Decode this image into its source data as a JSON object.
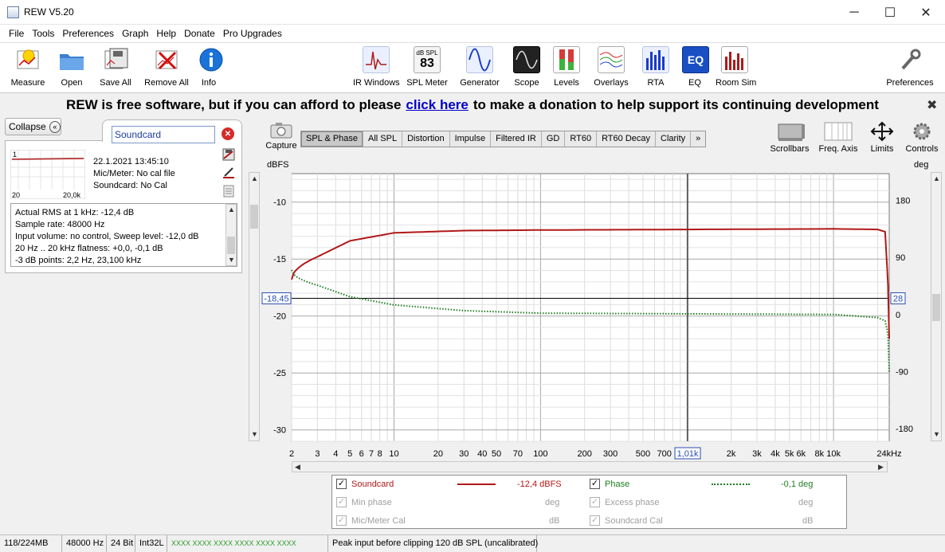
{
  "window": {
    "title": "REW V5.20",
    "minimize": "─",
    "maximize": "☐",
    "close": "✕"
  },
  "menu": [
    "File",
    "Tools",
    "Preferences",
    "Graph",
    "Help",
    "Donate",
    "Pro Upgrades"
  ],
  "toolbar": {
    "left": [
      {
        "label": "Measure",
        "icon": "microphone-icon"
      },
      {
        "label": "Open",
        "icon": "folder-icon"
      },
      {
        "label": "Save All",
        "icon": "save-all-icon"
      },
      {
        "label": "Remove All",
        "icon": "remove-all-icon"
      },
      {
        "label": "Info",
        "icon": "info-icon"
      }
    ],
    "center": [
      {
        "label": "IR Windows",
        "icon": "ir-windows-icon"
      },
      {
        "label": "SPL Meter",
        "icon": "spl-meter-icon",
        "badge_top": "dB SPL",
        "badge_value": "83"
      },
      {
        "label": "Generator",
        "icon": "generator-icon"
      },
      {
        "label": "Scope",
        "icon": "scope-icon"
      },
      {
        "label": "Levels",
        "icon": "levels-icon"
      },
      {
        "label": "Overlays",
        "icon": "overlays-icon"
      },
      {
        "label": "RTA",
        "icon": "rta-icon"
      },
      {
        "label": "EQ",
        "icon": "eq-icon"
      },
      {
        "label": "Room Sim",
        "icon": "room-sim-icon"
      }
    ],
    "right": {
      "label": "Preferences",
      "icon": "wrench-icon"
    }
  },
  "banner": {
    "before": "REW is free software, but if you can afford to please",
    "link": "click here",
    "after": "to make a donation to help support its continuing development",
    "close": "✖"
  },
  "left_panel": {
    "collapse": "Collapse",
    "measurement_name": "Soundcard",
    "date": "22.1.2021 13:45:10",
    "mic": "Mic/Meter: No cal file",
    "soundcard": "Soundcard: No Cal",
    "thumb_left": "20",
    "thumb_right": "20,0k",
    "thumb_index": "1",
    "info_lines": [
      "Actual RMS at 1 kHz: -12,4 dB",
      "Sample rate: 48000 Hz",
      "Input volume: no control, Sweep level: -12,0 dB",
      "20 Hz .. 20 kHz flatness: +0,0, -0,1 dB",
      " -3 dB points: 2,2 Hz,  23,100 kHz"
    ]
  },
  "graph": {
    "capture": "Capture",
    "tabs": [
      "SPL & Phase",
      "All SPL",
      "Distortion",
      "Impulse",
      "Filtered IR",
      "GD",
      "RT60",
      "RT60 Decay",
      "Clarity",
      "»"
    ],
    "active_tab": "SPL & Phase",
    "right_tools": [
      "Scrollbars",
      "Freq. Axis",
      "Limits",
      "Controls"
    ],
    "left_unit": "dBFS",
    "right_unit": "deg",
    "left_ticks": [
      "-10",
      "-15",
      "-20",
      "-25",
      "-30"
    ],
    "right_ticks": [
      "180",
      "90",
      "0",
      "-90",
      "-180"
    ],
    "x_ticks": [
      "2",
      "3",
      "4",
      "5",
      "6",
      "7",
      "8",
      "10",
      "20",
      "30",
      "40",
      "50",
      "70",
      "100",
      "200",
      "300",
      "500",
      "700",
      "1,01k",
      "2k",
      "3k",
      "4k",
      "5k",
      "6k",
      "8k",
      "10k",
      "24kHz"
    ],
    "cursor_left": "-18,45",
    "cursor_right": "28",
    "cursor_x": "1,01k"
  },
  "chart_data": {
    "type": "line",
    "xlim": [
      2,
      24000
    ],
    "x_scale": "log",
    "ylim": [
      -31,
      -7.5
    ],
    "y2lim": [
      -200,
      222
    ],
    "series": [
      {
        "name": "Soundcard",
        "axis": "left",
        "color": "#b01818",
        "style": "solid",
        "x": [
          2,
          3,
          5,
          10,
          30,
          100,
          1000,
          10000,
          20000,
          22500,
          23500,
          24000
        ],
        "y": [
          -16.8,
          -14.8,
          -13.4,
          -12.7,
          -12.5,
          -12.45,
          -12.4,
          -12.35,
          -12.4,
          -12.6,
          -17,
          -22
        ]
      },
      {
        "name": "Phase",
        "axis": "right",
        "color": "#1f7f1f",
        "style": "dotted",
        "x": [
          2,
          3,
          5,
          10,
          30,
          100,
          1000,
          10000,
          20000,
          22500,
          23500,
          24000
        ],
        "y": [
          70,
          46,
          28,
          15,
          6,
          2,
          1,
          0,
          -5,
          -10,
          -30,
          -90
        ]
      }
    ]
  },
  "legend": {
    "rows": [
      {
        "name": "Soundcard",
        "value": "-12,4 dBFS",
        "name2": "Phase",
        "value2": "-0,1 deg",
        "enabled": true
      },
      {
        "name": "Min phase",
        "value": "deg",
        "name2": "Excess phase",
        "value2": "deg",
        "enabled": false
      },
      {
        "name": "Mic/Meter Cal",
        "value": "dB",
        "name2": "Soundcard Cal",
        "value2": "dB",
        "enabled": false
      }
    ],
    "check": "✓"
  },
  "status": {
    "memory": "118/224MB",
    "rate": "48000 Hz",
    "bits": "24 Bit",
    "format": "Int32L",
    "meters": "XXXX XXXX  XXXX XXXX  XXXX XXXX",
    "message": "Peak input before clipping 120 dB SPL (uncalibrated)"
  },
  "colors": {
    "accent": "#0000cc",
    "trace_spl": "#b01818",
    "trace_phase": "#1f7f1f",
    "cursor_box": "#2a4db0"
  }
}
